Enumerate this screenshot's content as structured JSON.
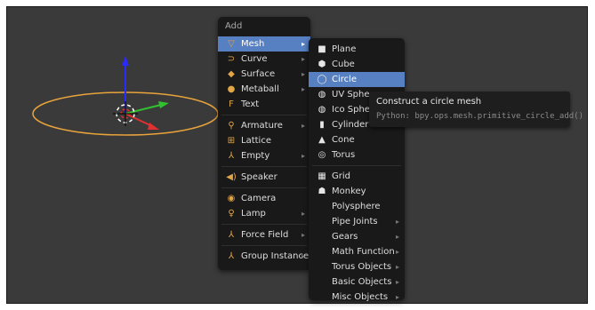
{
  "add_menu": {
    "title": "Add",
    "items": [
      {
        "label": "Mesh",
        "icon": "mesh-icon",
        "glyph": "▽",
        "color": "#e39a46",
        "submenu": true,
        "active": true
      },
      {
        "label": "Curve",
        "icon": "curve-icon",
        "glyph": "⊃",
        "color": "#e3a646",
        "submenu": true
      },
      {
        "label": "Surface",
        "icon": "surface-icon",
        "glyph": "◆",
        "color": "#e3a646",
        "submenu": true
      },
      {
        "label": "Metaball",
        "icon": "metaball-icon",
        "glyph": "●",
        "color": "#e3a646",
        "submenu": true
      },
      {
        "label": "Text",
        "icon": "text-icon",
        "glyph": "F",
        "color": "#e3a646"
      },
      {
        "label": "Armature",
        "icon": "armature-icon",
        "glyph": "⚲",
        "color": "#e3a646",
        "submenu": true
      },
      {
        "label": "Lattice",
        "icon": "lattice-icon",
        "glyph": "⊞",
        "color": "#e3a646"
      },
      {
        "label": "Empty",
        "icon": "empty-icon",
        "glyph": "⅄",
        "color": "#e3a646",
        "submenu": true
      },
      {
        "label": "Speaker",
        "icon": "speaker-icon",
        "glyph": "◀)",
        "color": "#e3a646"
      },
      {
        "label": "Camera",
        "icon": "camera-icon",
        "glyph": "◉",
        "color": "#e3a646"
      },
      {
        "label": "Lamp",
        "icon": "lamp-icon",
        "glyph": "♀",
        "color": "#e3a646",
        "submenu": true
      },
      {
        "label": "Force Field",
        "icon": "force-field-icon",
        "glyph": "⅄",
        "color": "#e3a646",
        "submenu": true
      },
      {
        "label": "Group Instance",
        "icon": "group-instance-icon",
        "glyph": "⅄",
        "color": "#e3a646",
        "submenu": true
      }
    ]
  },
  "mesh_menu": {
    "items": [
      {
        "label": "Plane",
        "icon": "plane-icon",
        "glyph": "■"
      },
      {
        "label": "Cube",
        "icon": "cube-icon",
        "glyph": "⬢"
      },
      {
        "label": "Circle",
        "icon": "circle-icon",
        "glyph": "◯",
        "active": true
      },
      {
        "label": "UV Sphere",
        "icon": "uv-sphere-icon",
        "glyph": "◍"
      },
      {
        "label": "Ico Sphere",
        "icon": "ico-sphere-icon",
        "glyph": "◍"
      },
      {
        "label": "Cylinder",
        "icon": "cylinder-icon",
        "glyph": "▮"
      },
      {
        "label": "Cone",
        "icon": "cone-icon",
        "glyph": "▲"
      },
      {
        "label": "Torus",
        "icon": "torus-icon",
        "glyph": "◎"
      },
      {
        "label": "Grid",
        "icon": "grid-icon",
        "glyph": "▦"
      },
      {
        "label": "Monkey",
        "icon": "monkey-icon",
        "glyph": "☗"
      },
      {
        "label": "Polysphere"
      },
      {
        "label": "Pipe Joints",
        "submenu": true
      },
      {
        "label": "Gears",
        "submenu": true
      },
      {
        "label": "Math Function",
        "submenu": true
      },
      {
        "label": "Torus Objects",
        "submenu": true
      },
      {
        "label": "Basic Objects",
        "submenu": true
      },
      {
        "label": "Misc Objects",
        "submenu": true
      }
    ]
  },
  "tooltip": {
    "title": "Construct a circle mesh",
    "python": "Python: bpy.ops.mesh.primitive_circle_add()"
  },
  "colors": {
    "viewport_bg": "#3a3a3a",
    "menu_bg": "#191919",
    "highlight": "#5680c2",
    "circle_outline": "#e8a33b",
    "axis_x": "#e03030",
    "axis_y": "#30c030",
    "axis_z": "#2a2aff"
  }
}
